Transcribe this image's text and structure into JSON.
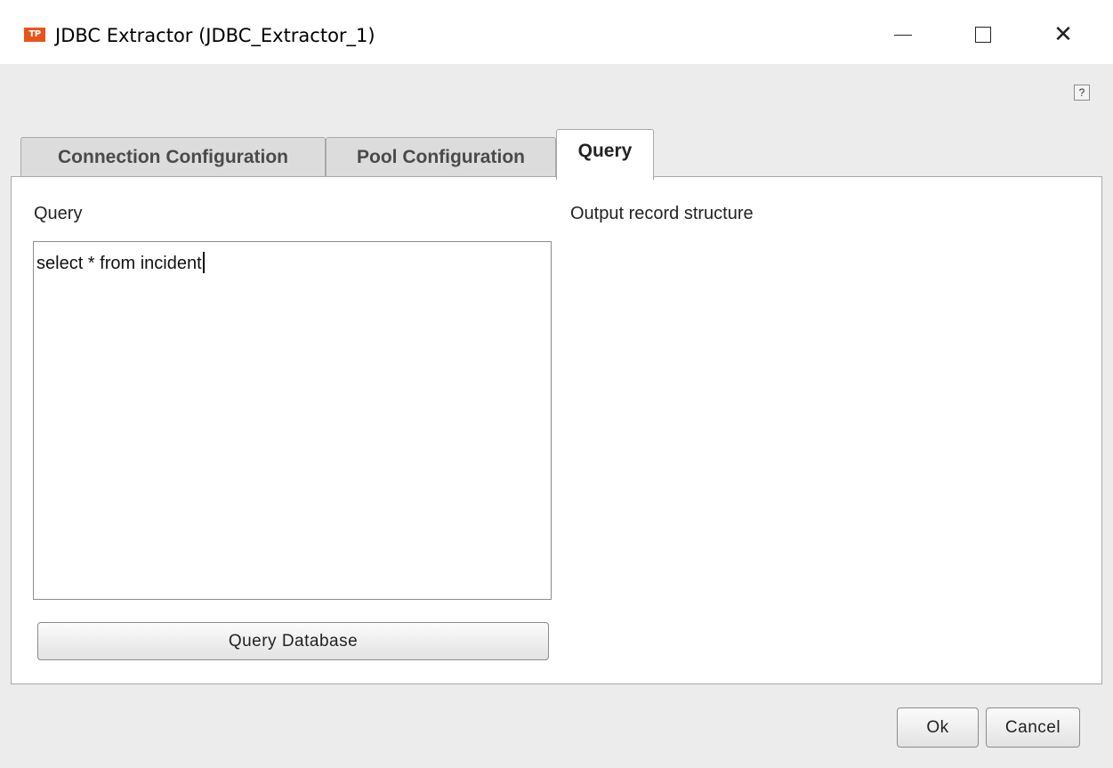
{
  "window": {
    "title": "JDBC Extractor (JDBC_Extractor_1)",
    "app_icon": "tp-logo-icon",
    "controls": [
      "minimize-icon",
      "maximize-icon",
      "close-icon"
    ]
  },
  "help": {
    "label": "?"
  },
  "tabs": [
    {
      "label": "Connection Configuration",
      "selected": false
    },
    {
      "label": "Pool Configuration",
      "selected": false
    },
    {
      "label": "Query",
      "selected": true
    }
  ],
  "query_tab": {
    "query_label": "Query",
    "query_value": "select * from incident",
    "output_label": "Output record structure",
    "query_button": "Query Database"
  },
  "footer": {
    "ok_label": "Ok",
    "cancel_label": "Cancel"
  },
  "colors": {
    "accent_icon": "#e8541c",
    "dialog_bg": "#ececec",
    "panel_bg": "#ffffff"
  }
}
